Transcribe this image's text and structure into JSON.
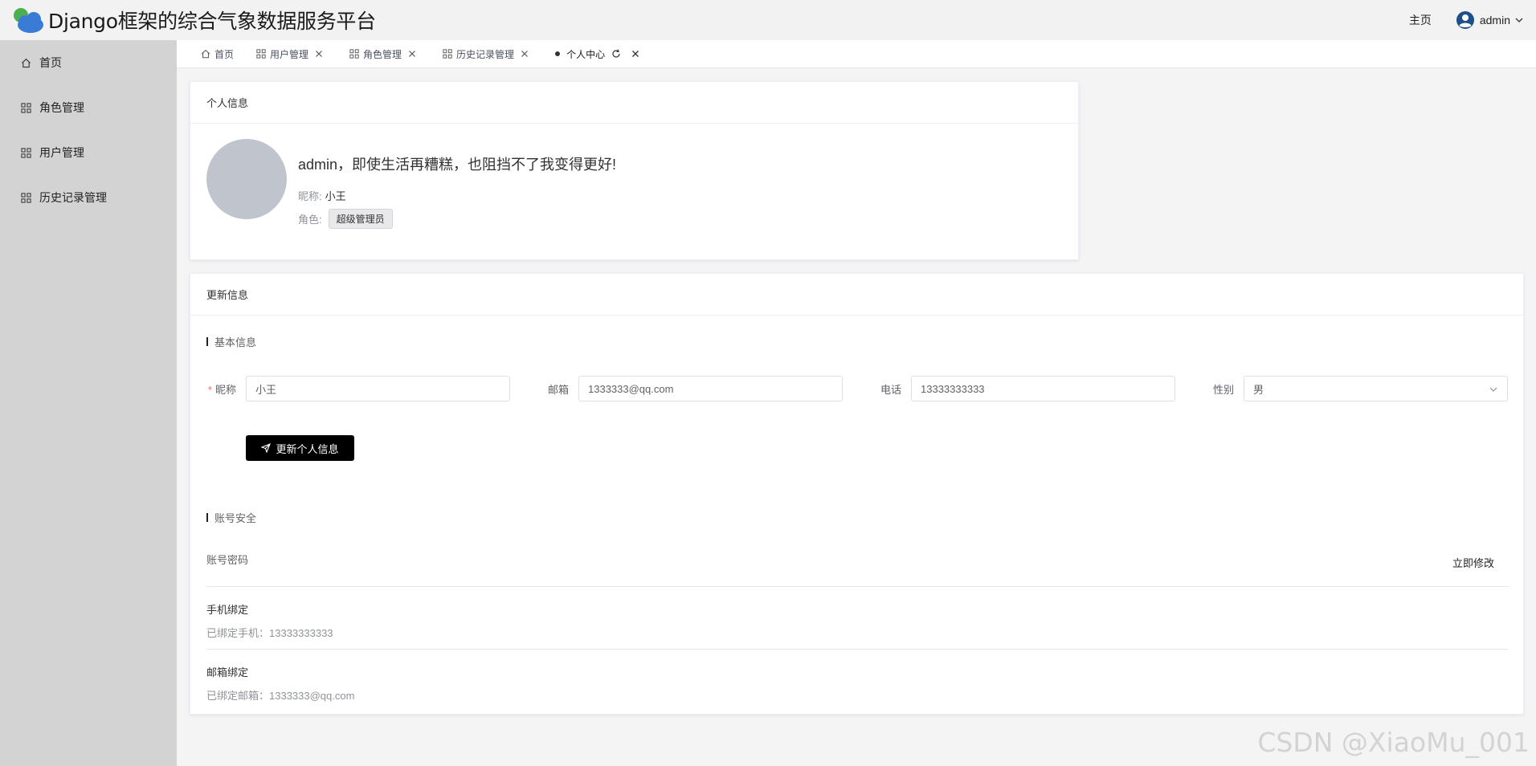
{
  "header": {
    "title": "Django框架的综合气象数据服务平台",
    "home_link": "主页",
    "username": "admin"
  },
  "sidebar": {
    "items": [
      {
        "label": "首页",
        "icon": "home-icon"
      },
      {
        "label": "角色管理",
        "icon": "grid-icon"
      },
      {
        "label": "用户管理",
        "icon": "grid-icon"
      },
      {
        "label": "历史记录管理",
        "icon": "grid-icon"
      }
    ]
  },
  "tabs": [
    {
      "label": "首页"
    },
    {
      "label": "用户管理"
    },
    {
      "label": "角色管理"
    },
    {
      "label": "历史记录管理"
    },
    {
      "label": "个人中心",
      "active": true
    }
  ],
  "profile": {
    "card_title": "个人信息",
    "greeting": "admin，即使生活再糟糕，也阻挡不了我变得更好!",
    "nickname_label": "昵称:",
    "nickname": "小王",
    "role_label": "角色:",
    "role": "超级管理员"
  },
  "update": {
    "card_title": "更新信息",
    "basic_title": "基本信息",
    "fields": {
      "nickname_label": "昵称",
      "nickname_value": "小王",
      "email_label": "邮箱",
      "email_value": "1333333@qq.com",
      "phone_label": "电话",
      "phone_value": "13333333333",
      "gender_label": "性别",
      "gender_value": "男"
    },
    "submit_label": "更新个人信息",
    "security_title": "账号安全",
    "password_title": "账号密码",
    "modify_label": "立即修改",
    "phone_bind_title": "手机绑定",
    "phone_bind_text": "已绑定手机：13333333333",
    "email_bind_title": "邮箱绑定",
    "email_bind_text": "已绑定邮箱：1333333@qq.com"
  },
  "watermark": "CSDN @XiaoMu_001",
  "colors": {
    "sidebar_bg": "#d3d3d3",
    "header_bg": "#f2f2f2",
    "primary_button": "#000000",
    "avatar_placeholder": "#c0c4cc"
  }
}
